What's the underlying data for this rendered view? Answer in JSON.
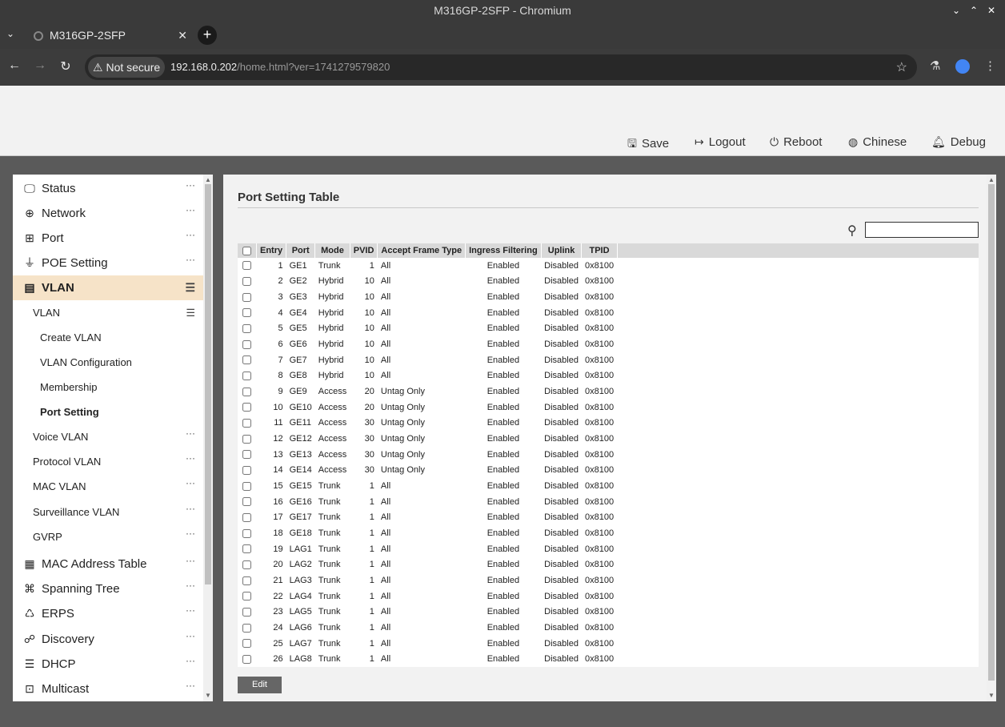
{
  "window": {
    "title": "M316GP-2SFP - Chromium",
    "controls": [
      "⌄",
      "⌃",
      "✕"
    ]
  },
  "tab": {
    "title": "M316GP-2SFP"
  },
  "address_bar": {
    "security": "Not secure",
    "host": "192.168.0.202",
    "path": "/home.html?ver=1741279579820"
  },
  "header": {
    "buttons": [
      {
        "label": "Save",
        "icon": "save-icon"
      },
      {
        "label": "Logout",
        "icon": "logout-icon"
      },
      {
        "label": "Reboot",
        "icon": "power-icon"
      },
      {
        "label": "Chinese",
        "icon": "language-icon"
      },
      {
        "label": "Debug",
        "icon": "bell-icon"
      }
    ]
  },
  "sidebar": {
    "items": [
      {
        "label": "Status",
        "icon": "monitor-icon"
      },
      {
        "label": "Network",
        "icon": "globe-icon"
      },
      {
        "label": "Port",
        "icon": "port-icon"
      },
      {
        "label": "POE Setting",
        "icon": "plug-icon"
      },
      {
        "label": "VLAN",
        "icon": "list-icon",
        "active": true
      },
      {
        "label": "MAC Address Table",
        "icon": "table-icon"
      },
      {
        "label": "Spanning Tree",
        "icon": "tree-icon"
      },
      {
        "label": "ERPS",
        "icon": "ring-icon"
      },
      {
        "label": "Discovery",
        "icon": "discovery-icon"
      },
      {
        "label": "DHCP",
        "icon": "database-icon"
      },
      {
        "label": "Multicast",
        "icon": "multicast-icon"
      }
    ],
    "vlan_sub": [
      {
        "label": "VLAN",
        "level": 1,
        "marker": "menu"
      },
      {
        "label": "Create VLAN",
        "level": 2
      },
      {
        "label": "VLAN Configuration",
        "level": 2
      },
      {
        "label": "Membership",
        "level": 2
      },
      {
        "label": "Port Setting",
        "level": 2,
        "current": true
      },
      {
        "label": "Voice VLAN",
        "level": 1,
        "marker": "more"
      },
      {
        "label": "Protocol VLAN",
        "level": 1,
        "marker": "more"
      },
      {
        "label": "MAC VLAN",
        "level": 1,
        "marker": "more"
      },
      {
        "label": "Surveillance VLAN",
        "level": 1,
        "marker": "more"
      },
      {
        "label": "GVRP",
        "level": 1,
        "marker": "more"
      }
    ]
  },
  "content": {
    "title": "Port Setting Table",
    "search": {
      "value": "",
      "placeholder": ""
    },
    "columns": [
      "Entry",
      "Port",
      "Mode",
      "PVID",
      "Accept Frame Type",
      "Ingress Filtering",
      "Uplink",
      "TPID"
    ],
    "rows": [
      [
        1,
        "GE1",
        "Trunk",
        1,
        "All",
        "Enabled",
        "Disabled",
        "0x8100"
      ],
      [
        2,
        "GE2",
        "Hybrid",
        10,
        "All",
        "Enabled",
        "Disabled",
        "0x8100"
      ],
      [
        3,
        "GE3",
        "Hybrid",
        10,
        "All",
        "Enabled",
        "Disabled",
        "0x8100"
      ],
      [
        4,
        "GE4",
        "Hybrid",
        10,
        "All",
        "Enabled",
        "Disabled",
        "0x8100"
      ],
      [
        5,
        "GE5",
        "Hybrid",
        10,
        "All",
        "Enabled",
        "Disabled",
        "0x8100"
      ],
      [
        6,
        "GE6",
        "Hybrid",
        10,
        "All",
        "Enabled",
        "Disabled",
        "0x8100"
      ],
      [
        7,
        "GE7",
        "Hybrid",
        10,
        "All",
        "Enabled",
        "Disabled",
        "0x8100"
      ],
      [
        8,
        "GE8",
        "Hybrid",
        10,
        "All",
        "Enabled",
        "Disabled",
        "0x8100"
      ],
      [
        9,
        "GE9",
        "Access",
        20,
        "Untag Only",
        "Enabled",
        "Disabled",
        "0x8100"
      ],
      [
        10,
        "GE10",
        "Access",
        20,
        "Untag Only",
        "Enabled",
        "Disabled",
        "0x8100"
      ],
      [
        11,
        "GE11",
        "Access",
        30,
        "Untag Only",
        "Enabled",
        "Disabled",
        "0x8100"
      ],
      [
        12,
        "GE12",
        "Access",
        30,
        "Untag Only",
        "Enabled",
        "Disabled",
        "0x8100"
      ],
      [
        13,
        "GE13",
        "Access",
        30,
        "Untag Only",
        "Enabled",
        "Disabled",
        "0x8100"
      ],
      [
        14,
        "GE14",
        "Access",
        30,
        "Untag Only",
        "Enabled",
        "Disabled",
        "0x8100"
      ],
      [
        15,
        "GE15",
        "Trunk",
        1,
        "All",
        "Enabled",
        "Disabled",
        "0x8100"
      ],
      [
        16,
        "GE16",
        "Trunk",
        1,
        "All",
        "Enabled",
        "Disabled",
        "0x8100"
      ],
      [
        17,
        "GE17",
        "Trunk",
        1,
        "All",
        "Enabled",
        "Disabled",
        "0x8100"
      ],
      [
        18,
        "GE18",
        "Trunk",
        1,
        "All",
        "Enabled",
        "Disabled",
        "0x8100"
      ],
      [
        19,
        "LAG1",
        "Trunk",
        1,
        "All",
        "Enabled",
        "Disabled",
        "0x8100"
      ],
      [
        20,
        "LAG2",
        "Trunk",
        1,
        "All",
        "Enabled",
        "Disabled",
        "0x8100"
      ],
      [
        21,
        "LAG3",
        "Trunk",
        1,
        "All",
        "Enabled",
        "Disabled",
        "0x8100"
      ],
      [
        22,
        "LAG4",
        "Trunk",
        1,
        "All",
        "Enabled",
        "Disabled",
        "0x8100"
      ],
      [
        23,
        "LAG5",
        "Trunk",
        1,
        "All",
        "Enabled",
        "Disabled",
        "0x8100"
      ],
      [
        24,
        "LAG6",
        "Trunk",
        1,
        "All",
        "Enabled",
        "Disabled",
        "0x8100"
      ],
      [
        25,
        "LAG7",
        "Trunk",
        1,
        "All",
        "Enabled",
        "Disabled",
        "0x8100"
      ],
      [
        26,
        "LAG8",
        "Trunk",
        1,
        "All",
        "Enabled",
        "Disabled",
        "0x8100"
      ]
    ],
    "edit_label": "Edit"
  },
  "colors": {
    "active_nav_bg": "#f6e3c8",
    "header_bg": "#d9d9d9",
    "edit_btn_bg": "#666666"
  }
}
